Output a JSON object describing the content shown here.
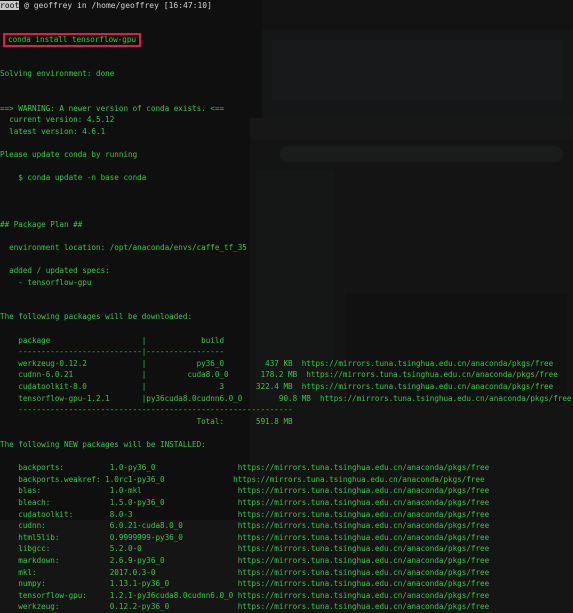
{
  "title": {
    "user": "root",
    "host_path": " @ geoffrey in /home/geoffrey [16:47:10]"
  },
  "command": "conda install tensorflow-gpu",
  "lines": [
    "Solving environment: done",
    "",
    "",
    "==> WARNING: A newer version of conda exists. <==",
    "  current version: 4.5.12",
    "  latest version: 4.6.1",
    "",
    "Please update conda by running",
    "",
    "    $ conda update -n base conda",
    "",
    "",
    "",
    "## Package Plan ##",
    "",
    "  environment location: /opt/anaconda/envs/caffe_tf_35",
    "",
    "  added / updated specs:",
    "    - tensorflow-gpu",
    "",
    "",
    "The following packages will be downloaded:",
    "",
    "    package                    |            build",
    "    ---------------------------|-----------------",
    "    werkzeug-0.12.2            |           py36_0         437 KB  https://mirrors.tuna.tsinghua.edu.cn/anaconda/pkgs/free",
    "    cudnn-6.0.21               |         cuda8.0_0       178.2 MB  https://mirrors.tuna.tsinghua.edu.cn/anaconda/pkgs/free",
    "    cudatoolkit-8.0            |                3       322.4 MB  https://mirrors.tuna.tsinghua.edu.cn/anaconda/pkgs/free",
    "    tensorflow-gpu-1.2.1       |py36cuda8.0cudnn6.0_0        90.8 MB  https://mirrors.tuna.tsinghua.edu.cn/anaconda/pkgs/free",
    "    ------------------------------------------------------------",
    "                                           Total:       591.8 MB",
    "",
    "The following NEW packages will be INSTALLED:",
    "",
    "    backports:          1.0-py36_0                  https://mirrors.tuna.tsinghua.edu.cn/anaconda/pkgs/free",
    "    backports.weakref: 1.0rc1-py36_0               https://mirrors.tuna.tsinghua.edu.cn/anaconda/pkgs/free",
    "    blas:               1.0-mkl                     https://mirrors.tuna.tsinghua.edu.cn/anaconda/pkgs/free",
    "    bleach:             1.5.0-py36_0                https://mirrors.tuna.tsinghua.edu.cn/anaconda/pkgs/free",
    "    cudatoolkit:        8.0-3                       https://mirrors.tuna.tsinghua.edu.cn/anaconda/pkgs/free",
    "    cudnn:              6.0.21-cuda8.0_0            https://mirrors.tuna.tsinghua.edu.cn/anaconda/pkgs/free",
    "    html5lib:           0.9999999-py36_0            https://mirrors.tuna.tsinghua.edu.cn/anaconda/pkgs/free",
    "    libgcc:             5.2.0-0                     https://mirrors.tuna.tsinghua.edu.cn/anaconda/pkgs/free",
    "    markdown:           2.6.9-py36_0                https://mirrors.tuna.tsinghua.edu.cn/anaconda/pkgs/free",
    "    mkl:                2017.0.3-0                  https://mirrors.tuna.tsinghua.edu.cn/anaconda/pkgs/free",
    "    numpy:              1.13.1-py36_0               https://mirrors.tuna.tsinghua.edu.cn/anaconda/pkgs/free",
    "    tensorflow-gpu:     1.2.1-py36cuda8.0cudnn6.0_0 https://mirrors.tuna.tsinghua.edu.cn/anaconda/pkgs/free",
    "    werkzeug:           0.12.2-py36_0               https://mirrors.tuna.tsinghua.edu.cn/anaconda/pkgs/free"
  ],
  "colors": {
    "text": "#2ecc40",
    "highlight_box": "#e8174d",
    "background": "#151515"
  }
}
